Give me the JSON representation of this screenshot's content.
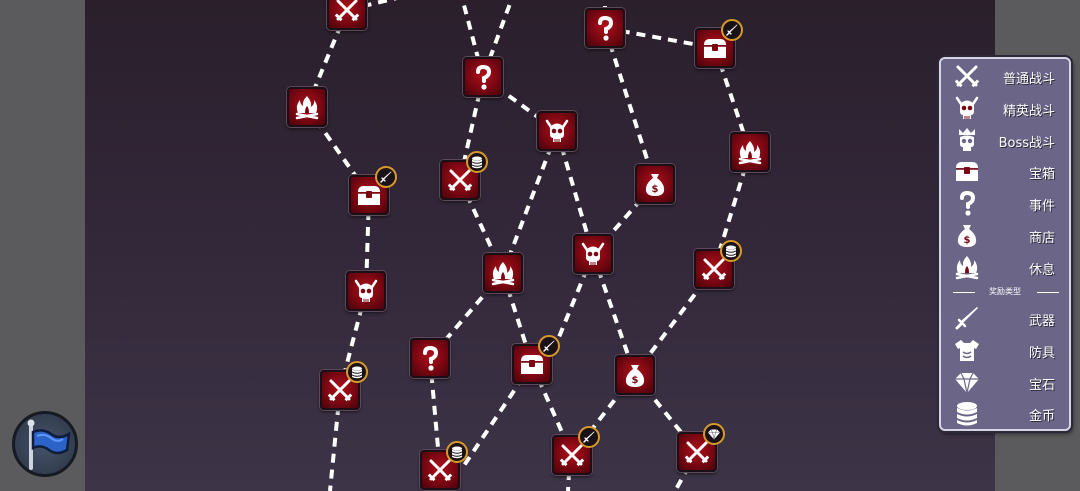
{
  "map": {
    "paths": [
      [
        [
          262,
          10
        ],
        [
          222,
          107
        ]
      ],
      [
        [
          222,
          107
        ],
        [
          284,
          195
        ]
      ],
      [
        [
          284,
          195
        ],
        [
          281,
          291
        ]
      ],
      [
        [
          281,
          291
        ],
        [
          255,
          390
        ]
      ],
      [
        [
          255,
          390
        ],
        [
          245,
          491
        ]
      ],
      [
        [
          262,
          10
        ],
        [
          345,
          -10
        ]
      ],
      [
        [
          375,
          -10
        ],
        [
          398,
          77
        ]
      ],
      [
        [
          430,
          -10
        ],
        [
          398,
          77
        ]
      ],
      [
        [
          398,
          77
        ],
        [
          375,
          180
        ]
      ],
      [
        [
          398,
          77
        ],
        [
          472,
          131
        ]
      ],
      [
        [
          375,
          180
        ],
        [
          418,
          273
        ]
      ],
      [
        [
          472,
          131
        ],
        [
          418,
          273
        ]
      ],
      [
        [
          418,
          273
        ],
        [
          345,
          358
        ]
      ],
      [
        [
          418,
          273
        ],
        [
          447,
          364
        ]
      ],
      [
        [
          345,
          358
        ],
        [
          355,
          470
        ]
      ],
      [
        [
          447,
          364
        ],
        [
          487,
          455
        ]
      ],
      [
        [
          447,
          364
        ],
        [
          376,
          470
        ]
      ],
      [
        [
          472,
          131
        ],
        [
          508,
          254
        ]
      ],
      [
        [
          508,
          254
        ],
        [
          570,
          184
        ]
      ],
      [
        [
          520,
          -10
        ],
        [
          520,
          28
        ]
      ],
      [
        [
          520,
          28
        ],
        [
          570,
          184
        ]
      ],
      [
        [
          520,
          28
        ],
        [
          630,
          48
        ]
      ],
      [
        [
          630,
          48
        ],
        [
          665,
          152
        ]
      ],
      [
        [
          665,
          152
        ],
        [
          629,
          269
        ]
      ],
      [
        [
          629,
          269
        ],
        [
          549,
          375
        ]
      ],
      [
        [
          508,
          254
        ],
        [
          550,
          375
        ]
      ],
      [
        [
          508,
          254
        ],
        [
          463,
          364
        ]
      ],
      [
        [
          550,
          375
        ],
        [
          612,
          452
        ]
      ],
      [
        [
          549,
          375
        ],
        [
          487,
          455
        ]
      ],
      [
        [
          612,
          452
        ],
        [
          590,
          491
        ]
      ],
      [
        [
          485,
          455
        ],
        [
          483,
          491
        ]
      ]
    ],
    "nodes": [
      {
        "type": "combat",
        "badge": ""
      },
      {
        "type": "rest",
        "badge": ""
      },
      {
        "type": "treasure",
        "badge": "weapon"
      },
      {
        "type": "elite",
        "badge": ""
      },
      {
        "type": "combat",
        "badge": "coin"
      },
      {
        "type": "event",
        "badge": ""
      },
      {
        "type": "combat",
        "badge": "coin"
      },
      {
        "type": "elite",
        "badge": ""
      },
      {
        "type": "rest",
        "badge": ""
      },
      {
        "type": "event",
        "badge": ""
      },
      {
        "type": "treasure",
        "badge": "weapon"
      },
      {
        "type": "combat",
        "badge": "coin"
      },
      {
        "type": "event",
        "badge": ""
      },
      {
        "type": "shop",
        "badge": ""
      },
      {
        "type": "elite",
        "badge": ""
      },
      {
        "type": "combat",
        "badge": "weapon"
      },
      {
        "type": "shop",
        "badge": ""
      },
      {
        "type": "treasure",
        "badge": "weapon"
      },
      {
        "type": "rest",
        "badge": ""
      },
      {
        "type": "combat",
        "badge": "coin"
      },
      {
        "type": "combat",
        "badge": "gem"
      }
    ]
  },
  "legend": {
    "items": [
      {
        "icon": "crossed-swords-icon",
        "label": "普通战斗"
      },
      {
        "icon": "elite-skull-icon",
        "label": "精英战斗"
      },
      {
        "icon": "boss-skull-icon",
        "label": "Boss战斗"
      },
      {
        "icon": "treasure-chest-icon",
        "label": "宝箱"
      },
      {
        "icon": "question-mark-icon",
        "label": "事件"
      },
      {
        "icon": "money-bag-icon",
        "label": "商店"
      },
      {
        "icon": "campfire-icon",
        "label": "休息"
      }
    ],
    "separator_label": "奖励类型",
    "rewards": [
      {
        "icon": "sword-icon",
        "label": "武器"
      },
      {
        "icon": "armor-icon",
        "label": "防具"
      },
      {
        "icon": "gem-icon",
        "label": "宝石"
      },
      {
        "icon": "coin-stack-icon",
        "label": "金币"
      }
    ]
  },
  "colors": {
    "node_red": "#b0101a",
    "legend_bg": "#6b6687",
    "badge_ring": "#d79a2a",
    "path": "#ffffff"
  },
  "flag_button": {
    "icon": "blue-flag-icon"
  }
}
